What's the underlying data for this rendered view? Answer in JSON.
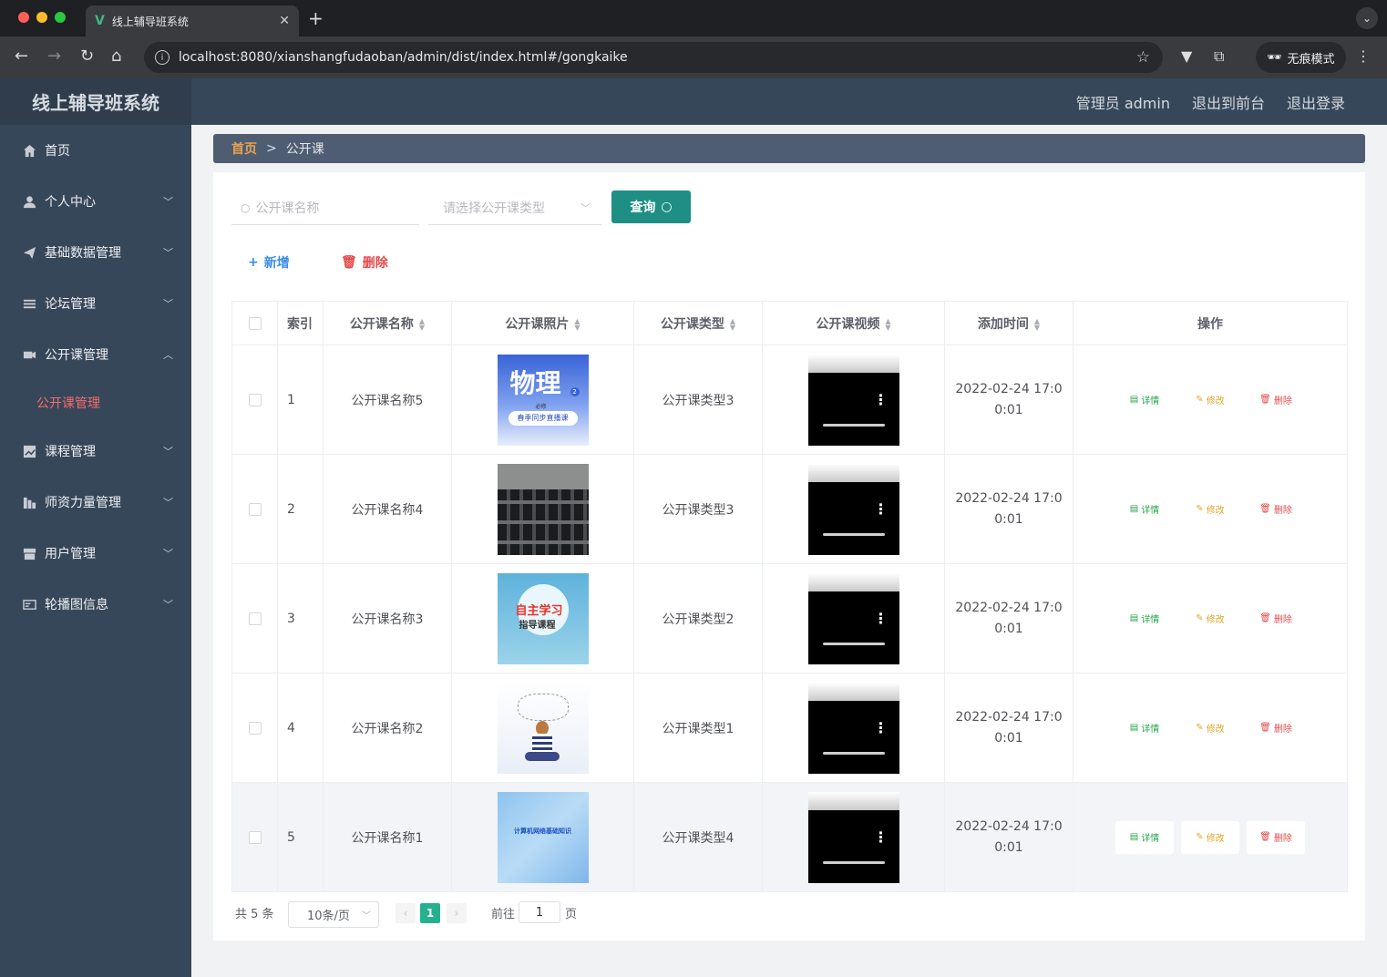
{
  "browser": {
    "tab_title": "线上辅导班系统",
    "url": "localhost:8080/xianshangfudaoban/admin/dist/index.html#/gongkaike",
    "incognito_label": "无痕模式"
  },
  "header": {
    "brand": "线上辅导班系统",
    "user_label": "管理员 admin",
    "to_front": "退出到前台",
    "logout": "退出登录"
  },
  "sidebar": {
    "items": [
      {
        "label": "首页",
        "icon": "home-icon"
      },
      {
        "label": "个人中心",
        "icon": "user-icon"
      },
      {
        "label": "基础数据管理",
        "icon": "send-icon"
      },
      {
        "label": "论坛管理",
        "icon": "list-icon"
      },
      {
        "label": "公开课管理",
        "icon": "ticket-icon"
      },
      {
        "label": "课程管理",
        "icon": "chart-icon"
      },
      {
        "label": "师资力量管理",
        "icon": "bars-icon"
      },
      {
        "label": "用户管理",
        "icon": "shop-icon"
      },
      {
        "label": "轮播图信息",
        "icon": "card-icon"
      }
    ],
    "active_sub": "公开课管理"
  },
  "breadcrumb": {
    "home": "首页",
    "separator": ">",
    "current": "公开课"
  },
  "search": {
    "name_placeholder": "公开课名称",
    "type_placeholder": "请选择公开课类型",
    "query_label": "查询"
  },
  "actions": {
    "add_label": "新增",
    "delete_label": "删除"
  },
  "table": {
    "headers": [
      "索引",
      "公开课名称",
      "公开课照片",
      "公开课类型",
      "公开课视频",
      "添加时间",
      "操作"
    ],
    "op_labels": {
      "view": "详情",
      "edit": "修改",
      "delete": "删除"
    },
    "rows": [
      {
        "index": "1",
        "name": "公开课名称5",
        "type": "公开课类型3",
        "time1": "2022-02-24 17:0",
        "time2": "0:01",
        "photo": "physics-book"
      },
      {
        "index": "2",
        "name": "公开课名称4",
        "type": "公开课类型3",
        "time1": "2022-02-24 17:0",
        "time2": "0:01",
        "photo": "classroom"
      },
      {
        "index": "3",
        "name": "公开课名称3",
        "type": "公开课类型2",
        "time1": "2022-02-24 17:0",
        "time2": "0:01",
        "photo": "self-study-book"
      },
      {
        "index": "4",
        "name": "公开课名称2",
        "type": "公开课类型1",
        "time1": "2022-02-24 17:0",
        "time2": "0:01",
        "photo": "girl-sketch"
      },
      {
        "index": "5",
        "name": "公开课名称1",
        "type": "公开课类型4",
        "time1": "2022-02-24 17:0",
        "time2": "0:01",
        "photo": "network-cover"
      }
    ]
  },
  "photo_text": {
    "physics_title": "物理",
    "physics_sub": "春季同步直播课",
    "physics_badge": "必修",
    "self_study_title": "自主学习",
    "self_study_sub": "指导课程",
    "network_title": "计算机网络基础知识"
  },
  "pagination": {
    "total_label": "共 5 条",
    "page_size": "10条/页",
    "current_page": "1",
    "goto_label": "前往",
    "goto_value": "1",
    "page_suffix": "页"
  },
  "colors": {
    "sidebar_bg": "#37475a",
    "query_btn": "#1f8f85",
    "active_sub": "#f56c6c",
    "breadcrumb_home": "#e8a34e"
  }
}
